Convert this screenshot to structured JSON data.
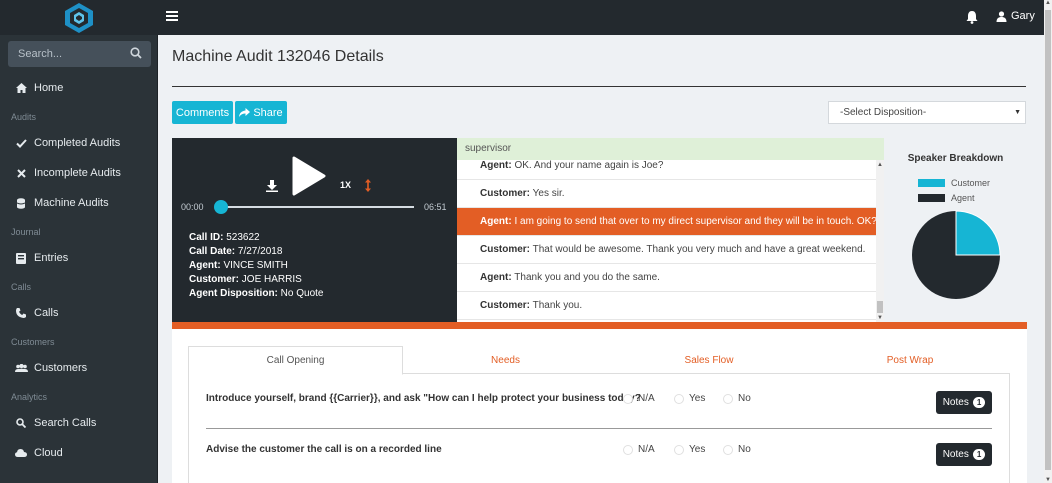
{
  "header": {
    "user_name": "Gary",
    "menu_icon": "hamburger-icon",
    "bell_icon": "bell-icon",
    "user_icon": "user-icon"
  },
  "sidebar": {
    "search_placeholder": "Search...",
    "items": {
      "home": "Home",
      "section_audits": "Audits",
      "completed": "Completed Audits",
      "incomplete": "Incomplete Audits",
      "machine": "Machine Audits",
      "section_journal": "Journal",
      "entries": "Entries",
      "section_calls": "Calls",
      "calls": "Calls",
      "section_customers": "Customers",
      "customers": "Customers",
      "section_analytics": "Analytics",
      "search_calls": "Search Calls",
      "cloud": "Cloud"
    }
  },
  "main": {
    "title": "Machine Audit 132046 Details",
    "comments_label": "Comments",
    "share_label": "Share",
    "disposition_placeholder": "-Select Disposition-"
  },
  "player": {
    "speed": "1X",
    "time_start": "00:00",
    "time_end": "06:51",
    "progress": 0.0,
    "call_id_label": "Call ID:",
    "call_id": "523622",
    "call_date_label": "Call Date:",
    "call_date": "7/27/2018",
    "agent_label": "Agent:",
    "agent": "VINCE SMITH",
    "customer_label": "Customer:",
    "customer": "JOE HARRIS",
    "disposition_label": "Agent Disposition:",
    "disposition": "No Quote"
  },
  "transcript": {
    "search_term": "supervisor",
    "lines": [
      {
        "speaker": "Agent:",
        "text": "OK. And your name again is Joe?"
      },
      {
        "speaker": "Customer:",
        "text": "Yes sir."
      },
      {
        "speaker": "Agent:",
        "text": "I am going to send that over to my direct supervisor and they will be in touch. OK?"
      },
      {
        "speaker": "Customer:",
        "text": "That would be awesome. Thank you very much and have a great weekend."
      },
      {
        "speaker": "Agent:",
        "text": "Thank you and you do the same."
      },
      {
        "speaker": "Customer:",
        "text": "Thank you."
      }
    ]
  },
  "speaker_breakdown": {
    "title": "Speaker Breakdown",
    "legend": [
      {
        "name": "Customer",
        "color": "#16b5d4"
      },
      {
        "name": "Agent",
        "color": "#23292e"
      }
    ],
    "customer_share": 0.25
  },
  "tabs": [
    "Call Opening",
    "Needs",
    "Sales Flow",
    "Post Wrap"
  ],
  "questions": [
    {
      "text": "Introduce yourself, brand {{Carrier}}, and ask \"How can I help protect your business today?",
      "options": [
        "N/A",
        "Yes",
        "No"
      ],
      "notes_label": "Notes",
      "notes_count": "1"
    },
    {
      "text": "Advise the customer the call is on a recorded line",
      "options": [
        "N/A",
        "Yes",
        "No"
      ],
      "notes_label": "Notes",
      "notes_count": "1"
    }
  ]
}
